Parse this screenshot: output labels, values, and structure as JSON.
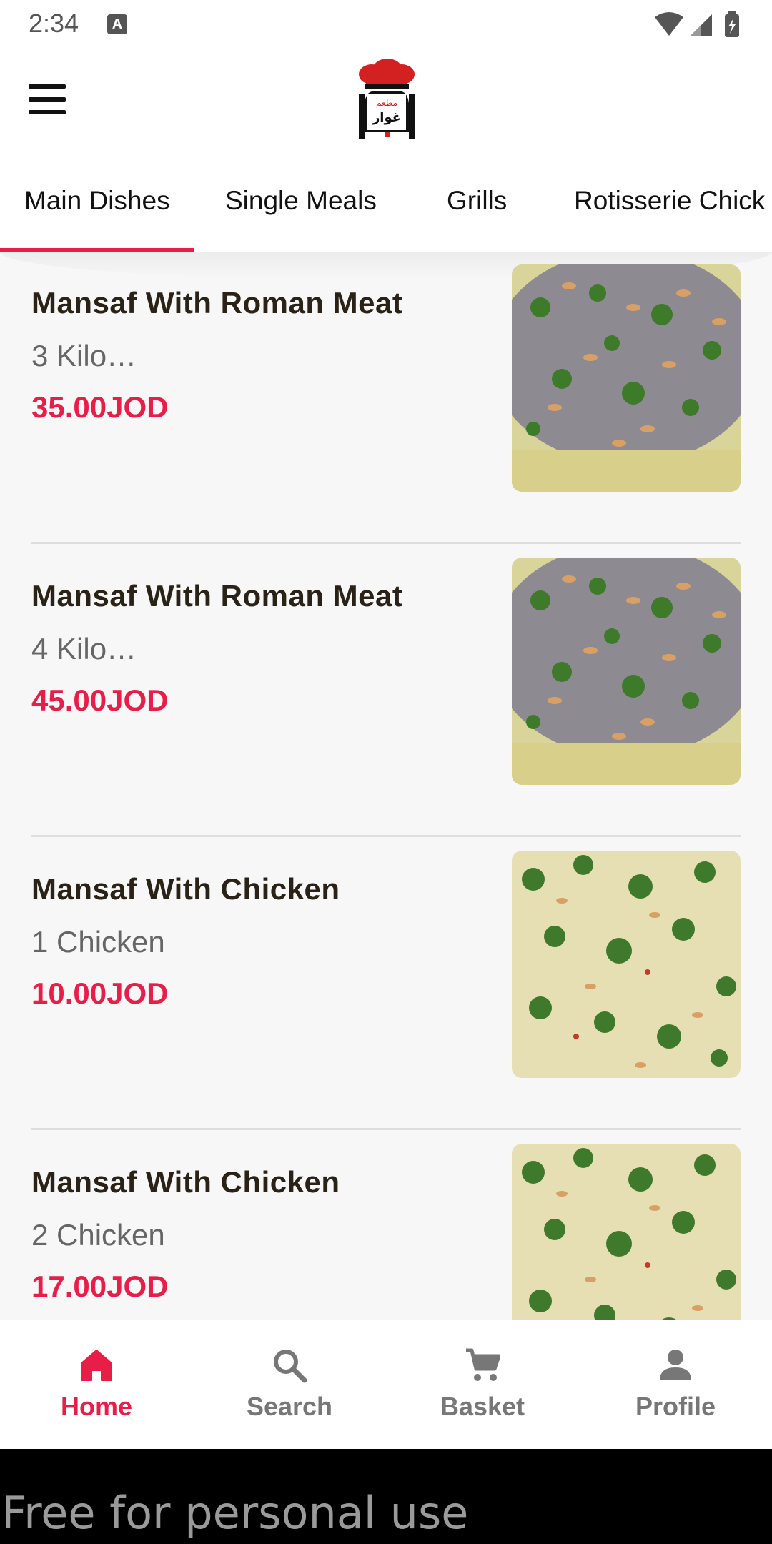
{
  "status_bar": {
    "time": "2:34",
    "notification_icon": "a-icon",
    "icons": [
      "wifi-icon",
      "cell-signal-icon",
      "battery-icon"
    ]
  },
  "app_bar": {
    "menu_icon": "hamburger-menu-icon",
    "logo": "restaurant-chef-hat-logo",
    "logo_text": "مطعم غوار"
  },
  "tabs": [
    {
      "label": "Main Dishes",
      "active": true
    },
    {
      "label": "Single Meals",
      "active": false
    },
    {
      "label": "Grills",
      "active": false
    },
    {
      "label": "Rotisserie Chick",
      "active": false
    }
  ],
  "items": [
    {
      "title": "Mansaf With Roman Meat",
      "desc": "3 Kilo…",
      "price": "35.00JOD",
      "image": "mansaf-meat-photo"
    },
    {
      "title": "Mansaf With Roman Meat",
      "desc": "4 Kilo…",
      "price": "45.00JOD",
      "image": "mansaf-meat-photo"
    },
    {
      "title": "Mansaf With Chicken",
      "desc": "1 Chicken",
      "price": "10.00JOD",
      "image": "mansaf-chicken-photo"
    },
    {
      "title": "Mansaf With Chicken",
      "desc": "2 Chicken",
      "price": "17.00JOD",
      "image": "mansaf-chicken-photo"
    }
  ],
  "bottom_nav": [
    {
      "label": "Home",
      "icon": "home-icon",
      "active": true
    },
    {
      "label": "Search",
      "icon": "search-icon",
      "active": false
    },
    {
      "label": "Basket",
      "icon": "cart-icon",
      "active": false
    },
    {
      "label": "Profile",
      "icon": "person-icon",
      "active": false
    }
  ],
  "colors": {
    "accent": "#e91e48",
    "title": "#2a2117",
    "muted": "#777777"
  },
  "watermark": "Free for personal use"
}
